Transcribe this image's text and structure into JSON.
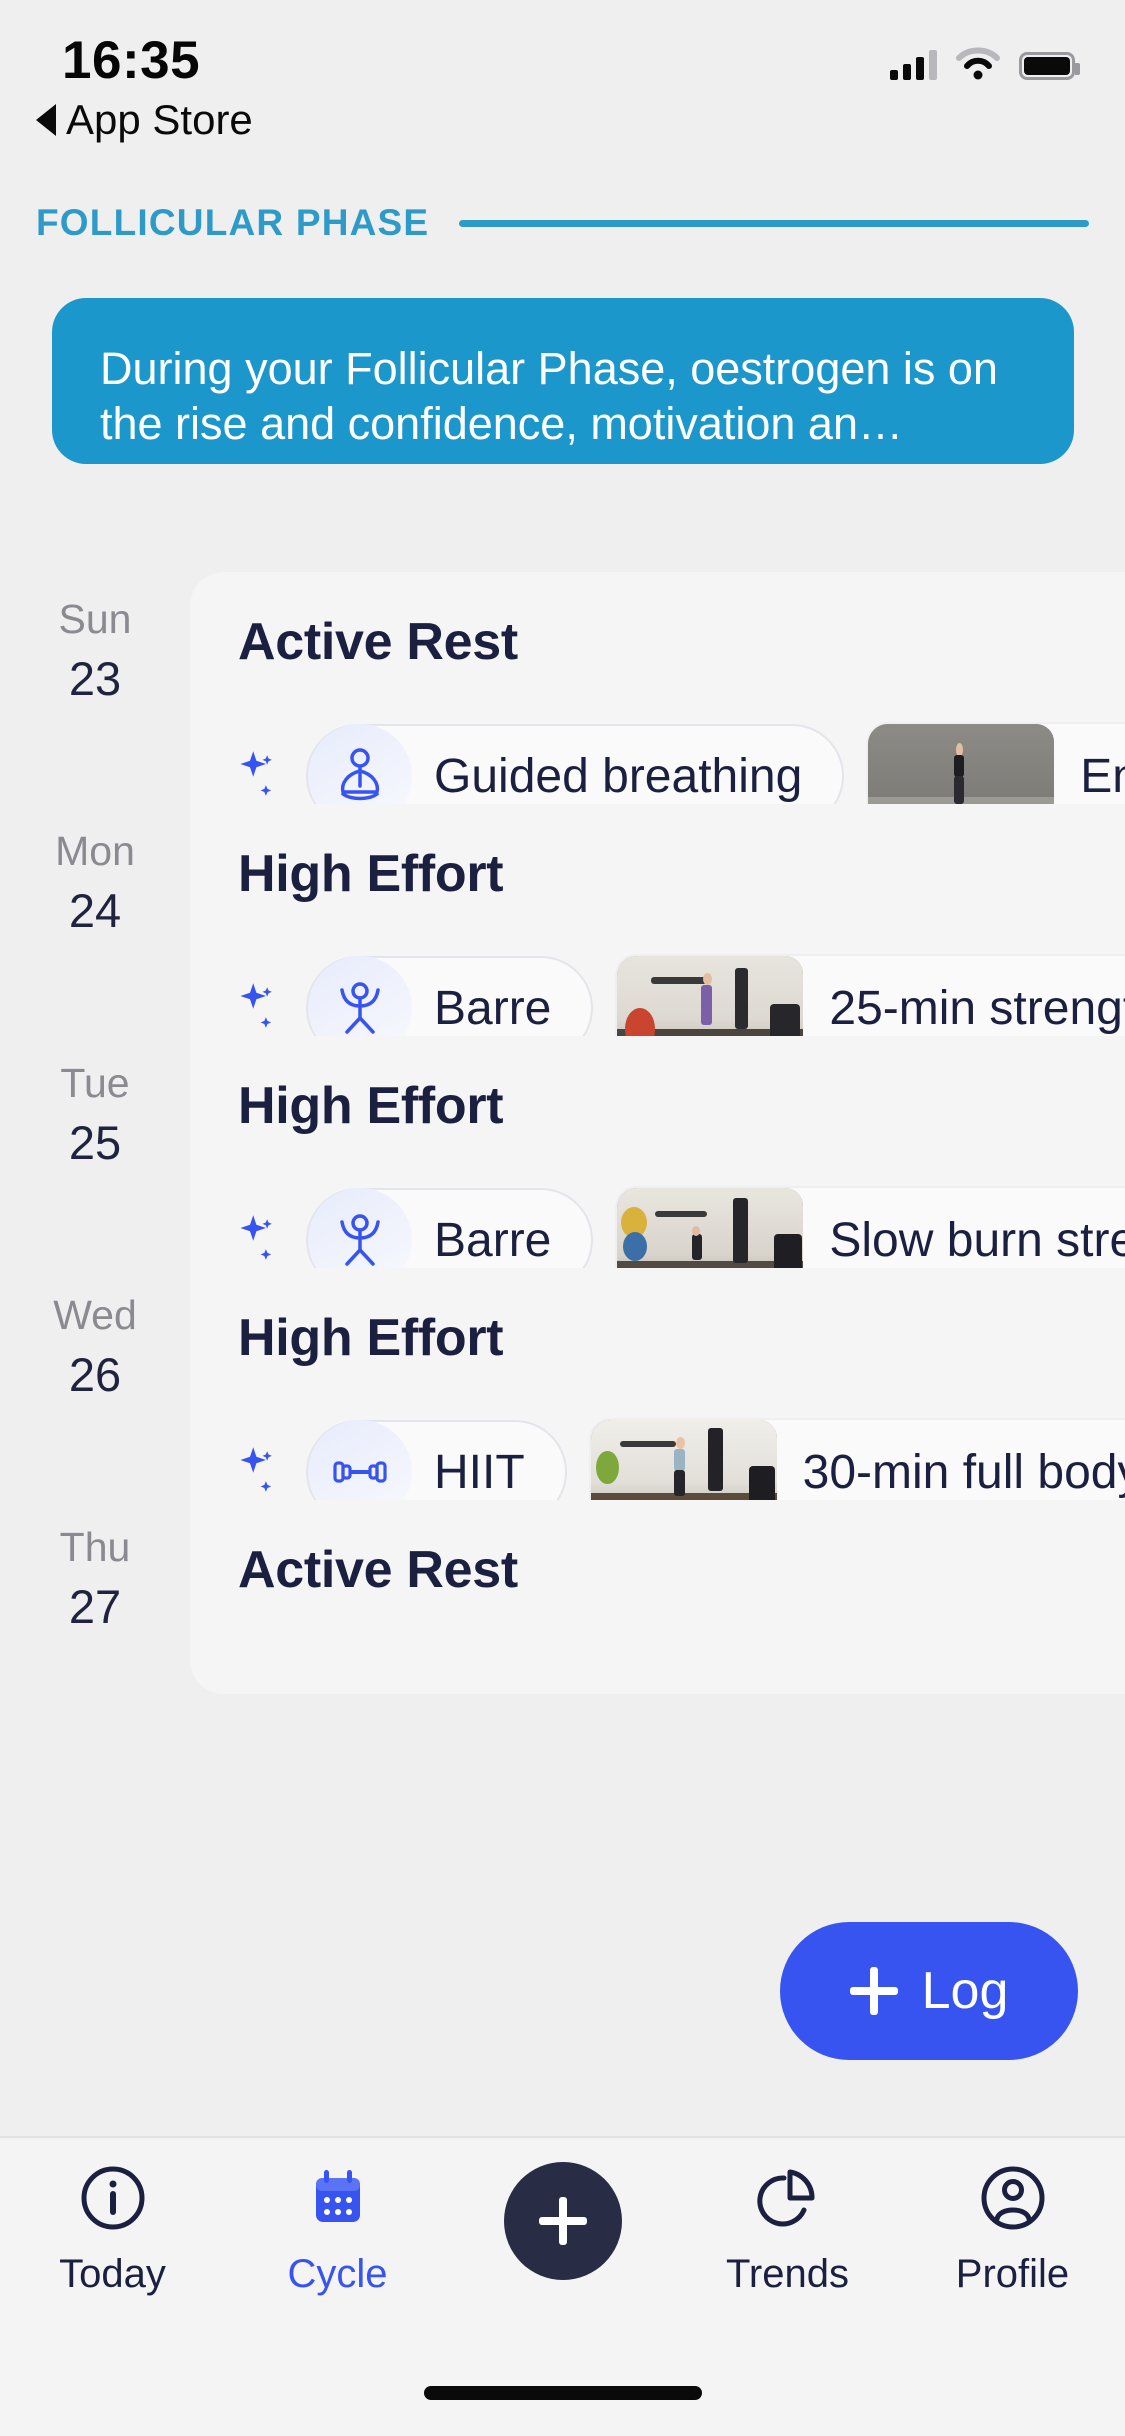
{
  "status_bar": {
    "time": "16:35",
    "back_label": "App Store",
    "back_icon": "triangle-left-icon",
    "signal_icon": "cellular-signal-icon",
    "wifi_icon": "wifi-icon",
    "battery_icon": "battery-full-icon"
  },
  "header": {
    "phase_label": "FOLLICULAR PHASE",
    "accent_color": "#2E9AC8"
  },
  "info_card": {
    "text": "During your Follicular Phase, oestrogen is on the rise and confidence, motivation an…",
    "background_color": "#1B97CC"
  },
  "days": [
    {
      "day_name": "Sun",
      "day_number": "23",
      "title": "Active Rest",
      "tag_icon": "meditation-icon",
      "tag_label": "Guided breathing",
      "workout_label": "En",
      "thumb_icon": "workout-thumbnail"
    },
    {
      "day_name": "Mon",
      "day_number": "24",
      "title": "High Effort",
      "tag_icon": "barre-person-icon",
      "tag_label": "Barre",
      "workout_label": "25-min strengt",
      "thumb_icon": "workout-thumbnail"
    },
    {
      "day_name": "Tue",
      "day_number": "25",
      "title": "High Effort",
      "tag_icon": "barre-person-icon",
      "tag_label": "Barre",
      "workout_label": "Slow burn stre",
      "thumb_icon": "workout-thumbnail"
    },
    {
      "day_name": "Wed",
      "day_number": "26",
      "title": "High Effort",
      "tag_icon": "dumbbell-icon",
      "tag_label": "HIIT",
      "workout_label": "30-min full body",
      "thumb_icon": "workout-thumbnail"
    },
    {
      "day_name": "Thu",
      "day_number": "27",
      "title": "Active Rest",
      "tag_icon": "meditation-icon",
      "tag_label": "",
      "workout_label": "",
      "thumb_icon": ""
    }
  ],
  "log_button": {
    "label": "Log",
    "icon": "plus-icon",
    "color": "#3754F0"
  },
  "tabbar": {
    "items": [
      {
        "label": "Today",
        "icon": "info-circle-icon",
        "active": false
      },
      {
        "label": "Cycle",
        "icon": "calendar-icon",
        "active": true
      },
      {
        "label": "",
        "icon": "plus-circle-icon",
        "active": false
      },
      {
        "label": "Trends",
        "icon": "pie-chart-icon",
        "active": false
      },
      {
        "label": "Profile",
        "icon": "person-circle-icon",
        "active": false
      }
    ],
    "active_color": "#3754F0"
  }
}
